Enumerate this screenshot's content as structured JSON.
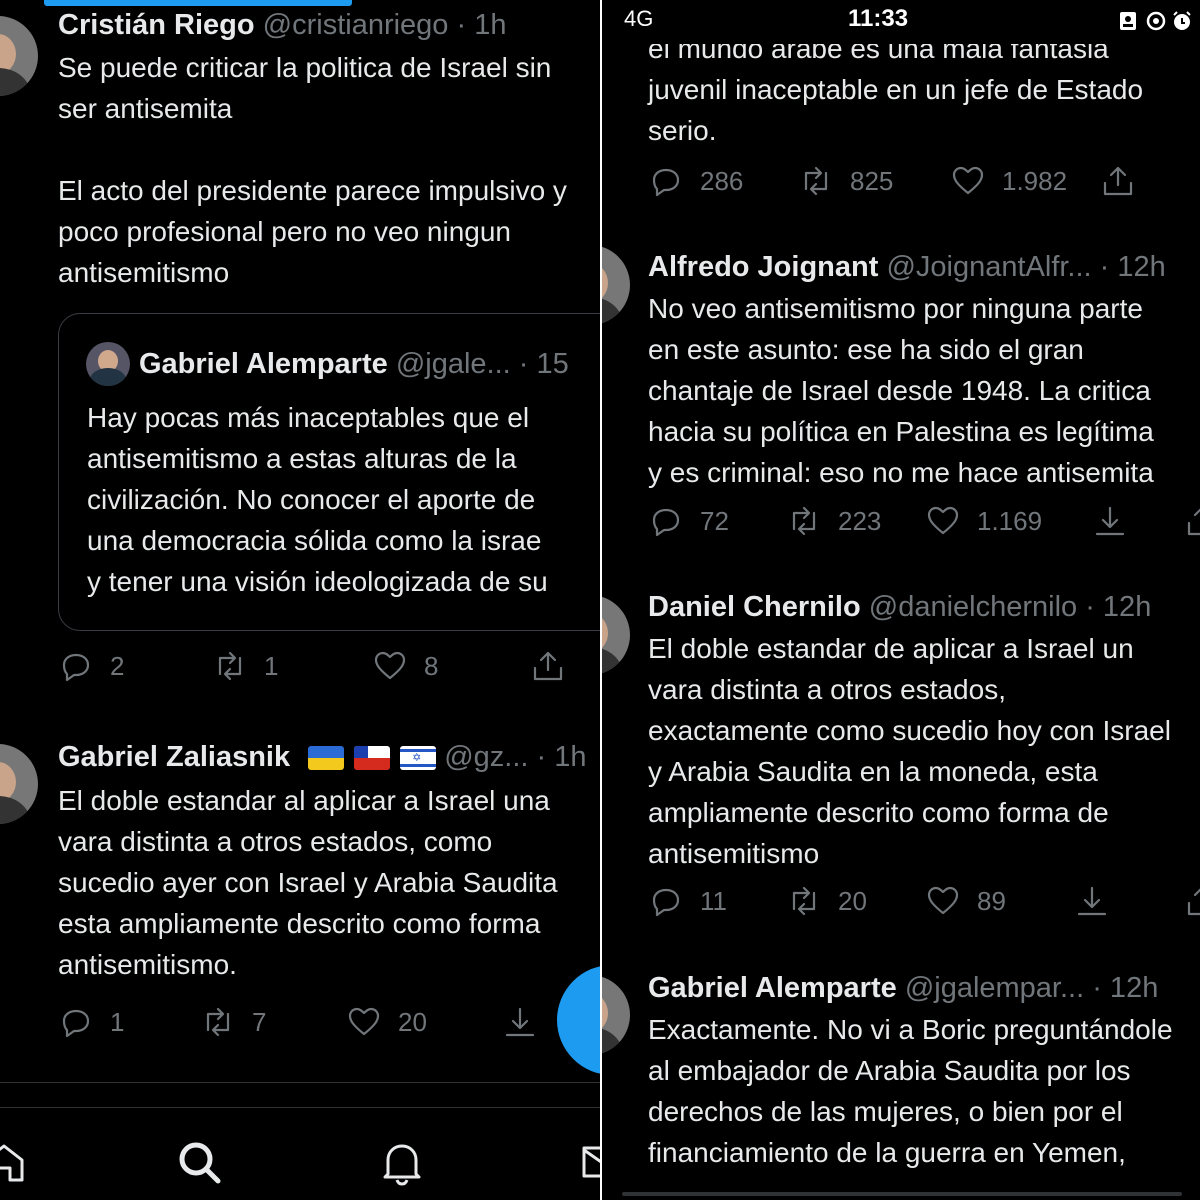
{
  "left": {
    "tweets": [
      {
        "name": "Cristián Riego",
        "handle_time": "@cristianriego · 1h",
        "text": "Se puede criticar la politica de Israel sin\nser antisemita\n\nEl acto del presidente parece impulsivo y\npoco profesional pero no veo ningun\nantisemitismo",
        "quote": {
          "name": "Gabriel Alemparte",
          "handle_time": "@jgale... · 15",
          "text": "Hay pocas más inaceptables que el\nantisemitismo a estas alturas de la\ncivilización. No conocer el aporte de\nuna democracia sólida como la israe\ny tener una visión ideologizada de su"
        },
        "replies": "2",
        "retweets": "1",
        "likes": "8"
      },
      {
        "name": "Gabriel Zaliasnik",
        "handle_time": "@gz... · 1h",
        "text": "El doble estandar al aplicar a Israel una\nvara distinta a otros estados, como\nsucedio ayer con Israel y Arabia Saudita\nesta ampliamente descrito como forma\nantisemitismo.",
        "replies": "1",
        "retweets": "7",
        "likes": "20"
      }
    ],
    "nav": [
      "home-icon",
      "search-icon",
      "bell-icon",
      "mail-icon"
    ]
  },
  "right": {
    "status": {
      "carrier": "4G",
      "time": "11:33"
    },
    "tweets": [
      {
        "text": "el mundo arabe es una mala fantasia\njuvenil inaceptable en un jefe de Estado\nserio.",
        "replies": "286",
        "retweets": "825",
        "likes": "1.982"
      },
      {
        "name": "Alfredo Joignant",
        "handle_time": "@JoignantAlfr... · 12h",
        "text": "No veo antisemitismo por ninguna parte\nen este asunto: ese ha sido el gran\nchantaje de Israel desde 1948. La critica\nhacia su política en Palestina es legítima\ny es criminal: eso no me hace antisemita",
        "replies": "72",
        "retweets": "223",
        "likes": "1.169"
      },
      {
        "name": "Daniel Chernilo",
        "handle_time": "@danielchernilo · 12h",
        "text": "El doble estandar de aplicar a Israel un\nvara distinta a otros estados,\nexactamente como sucedio hoy con Israel\ny Arabia Saudita en la moneda, esta\nampliamente descrito como forma de\nantisemitismo",
        "replies": "11",
        "retweets": "20",
        "likes": "89"
      },
      {
        "name": "Gabriel Alemparte",
        "handle_time": "@jgalempar... · 12h",
        "text": "Exactamente. No vi a Boric preguntándole\nal embajador de Arabia Saudita por los\nderechos de las mujeres, o bien por el\nfinanciamiento de la guerra en Yemen,"
      }
    ]
  },
  "colors": {
    "background": "#000000",
    "text": "#e7e9ea",
    "muted": "#71767b",
    "accent": "#1d9bf0",
    "divider": "#ffffff"
  }
}
